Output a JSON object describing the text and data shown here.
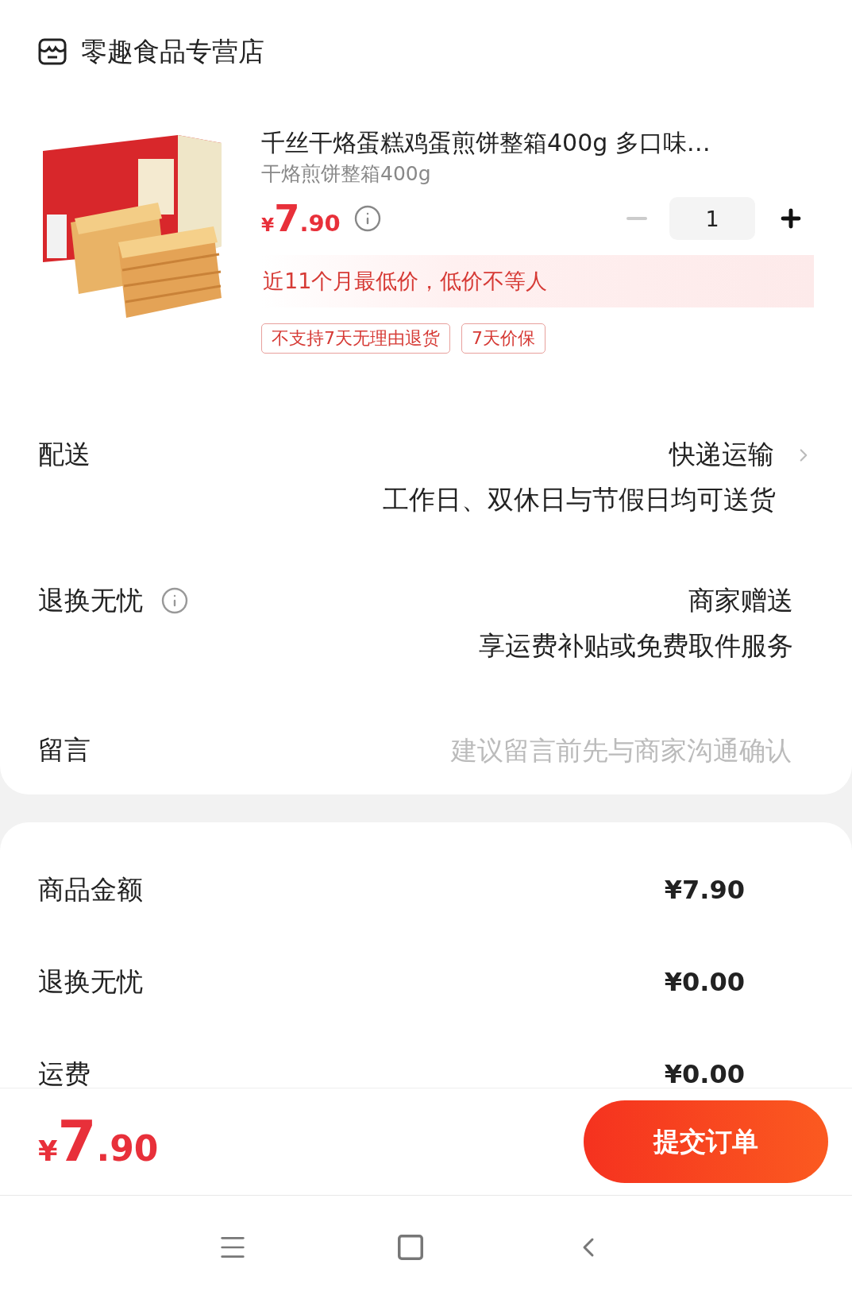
{
  "store": {
    "name": "零趣食品专营店"
  },
  "product": {
    "kind": "picture",
    "title": "千丝干烙蛋糕鸡蛋煎饼整箱400g 多口味…",
    "variant": "干烙煎饼整箱400g",
    "price": {
      "currency": "¥",
      "integer": "7",
      "decimal": ".90"
    },
    "quantity": {
      "value": "1",
      "decrement_disabled": true
    },
    "banner": "近11个月最低价，低价不等人",
    "tags": [
      "不支持7天无理由退货",
      "7天价保"
    ]
  },
  "options": [
    {
      "label": "配送",
      "info": false,
      "value": "快递运输",
      "note": "工作日、双休日与节假日均可送货",
      "chevron": true
    },
    {
      "label": "退换无忧",
      "info": true,
      "value": "商家赠送",
      "note": "享运费补贴或免费取件服务",
      "chevron": false
    }
  ],
  "message": {
    "label": "留言",
    "placeholder": "建议留言前先与商家沟通确认"
  },
  "summary": [
    {
      "label": "商品金额",
      "amount": "¥7.90"
    },
    {
      "label": "退换无忧",
      "amount": "¥0.00"
    },
    {
      "label": "运费",
      "amount": "¥0.00"
    }
  ],
  "footer": {
    "total": {
      "currency": "¥",
      "integer": "7",
      "decimal": ".90"
    },
    "submit": "提交订单"
  }
}
